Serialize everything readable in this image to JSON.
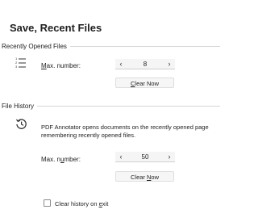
{
  "page": {
    "title": "Save, Recent Files"
  },
  "recent_files": {
    "section_label": "Recently Opened Files",
    "icon": "numbered-list-icon",
    "max_label_prefix": "",
    "max_label_accel": "M",
    "max_label_rest": "ax. number:",
    "max_value": "8",
    "clear_button_accel": "C",
    "clear_button_rest": "lear Now"
  },
  "file_history": {
    "section_label": "File History",
    "icon": "history-icon",
    "description_line1": "PDF Annotator opens documents on the recently opened page",
    "description_line2": "remembering recently opened files.",
    "max_label_prefix": "Max. n",
    "max_label_accel": "u",
    "max_label_rest": "mber:",
    "max_value": "50",
    "clear_button_prefix": "Clear ",
    "clear_button_accel": "N",
    "clear_button_rest": "ow",
    "checkbox_label_prefix": "Clear history on ",
    "checkbox_label_accel": "e",
    "checkbox_label_rest": "xit",
    "checkbox_checked": false
  },
  "icons": {
    "left_arrow": "‹",
    "right_arrow": "›"
  },
  "colors": {
    "background": "#ffffff",
    "rule": "#d6d6d6",
    "icon": "#333333"
  }
}
